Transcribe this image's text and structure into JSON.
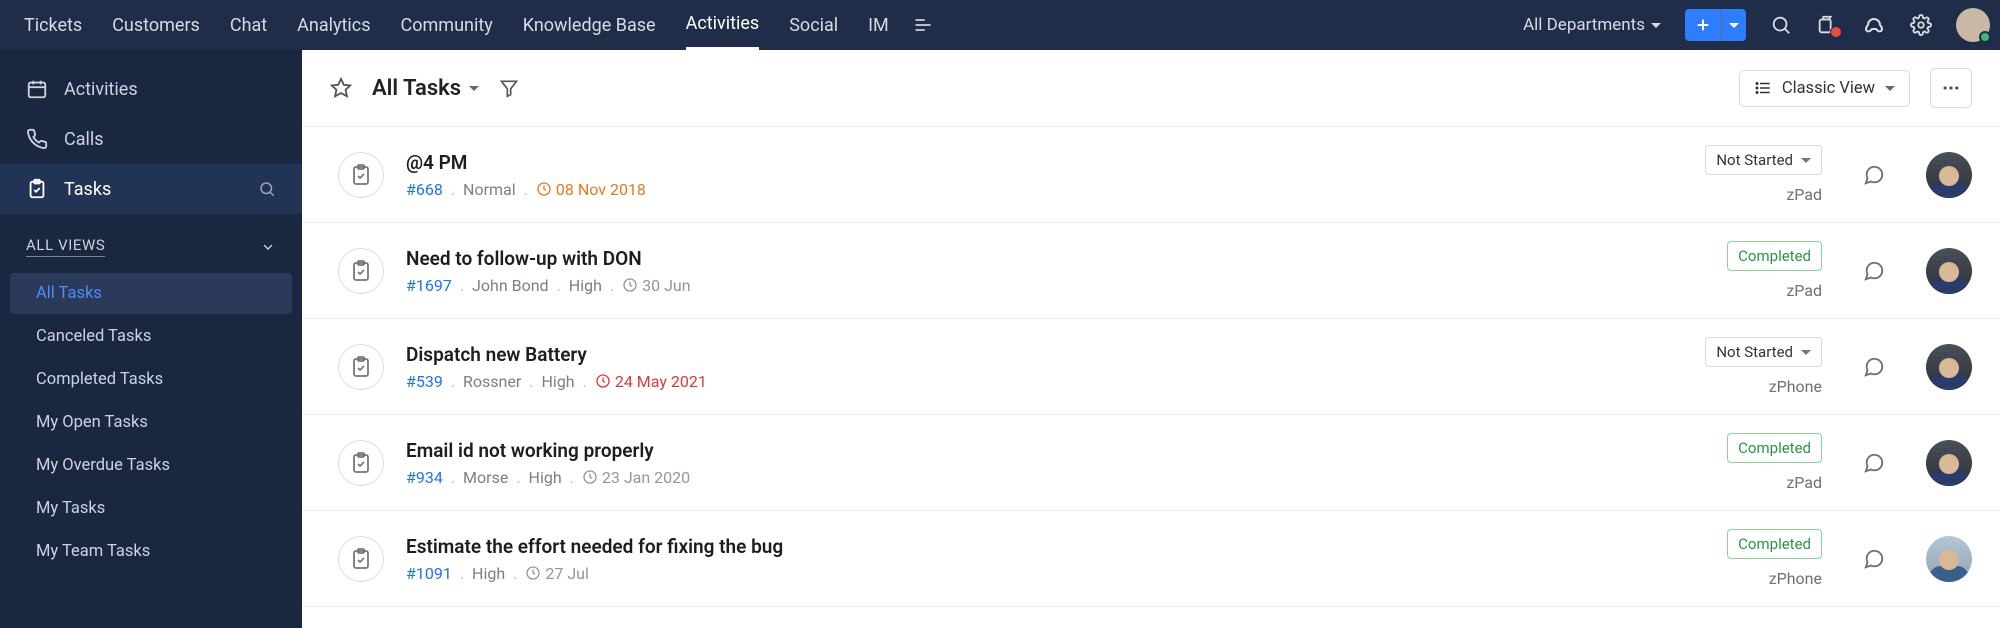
{
  "topnav": {
    "tabs": [
      "Tickets",
      "Customers",
      "Chat",
      "Analytics",
      "Community",
      "Knowledge Base",
      "Activities",
      "Social",
      "IM"
    ],
    "active_index": 6,
    "department_label": "All Departments"
  },
  "sidebar": {
    "primary": [
      {
        "icon": "calendar",
        "label": "Activities"
      },
      {
        "icon": "phone",
        "label": "Calls"
      },
      {
        "icon": "task",
        "label": "Tasks",
        "selected": true,
        "search": true
      }
    ],
    "section_label": "ALL VIEWS",
    "views": [
      {
        "label": "All Tasks",
        "active": true
      },
      {
        "label": "Canceled Tasks"
      },
      {
        "label": "Completed Tasks"
      },
      {
        "label": "My Open Tasks"
      },
      {
        "label": "My Overdue Tasks"
      },
      {
        "label": "My Tasks"
      },
      {
        "label": "My Team Tasks"
      }
    ]
  },
  "toolbar": {
    "title": "All Tasks",
    "view_mode_label": "Classic View"
  },
  "tasks": [
    {
      "title": "@4 PM",
      "id": "#668",
      "meta": [
        "Normal"
      ],
      "due": "08 Nov 2018",
      "due_style": "orange",
      "status": "Not Started",
      "status_kind": "dropdown",
      "category": "zPad",
      "avatar": "a"
    },
    {
      "title": "Need to follow-up with DON",
      "id": "#1697",
      "meta": [
        "John Bond",
        "High"
      ],
      "due": "30 Jun",
      "due_style": "grey",
      "status": "Completed",
      "status_kind": "completed",
      "category": "zPad",
      "avatar": "a"
    },
    {
      "title": "Dispatch new Battery",
      "id": "#539",
      "meta": [
        "Rossner",
        "High"
      ],
      "due": "24 May 2021",
      "due_style": "red",
      "status": "Not Started",
      "status_kind": "dropdown",
      "category": "zPhone",
      "avatar": "a"
    },
    {
      "title": "Email id not working properly",
      "id": "#934",
      "meta": [
        "Morse",
        "High"
      ],
      "due": "23 Jan 2020",
      "due_style": "grey",
      "status": "Completed",
      "status_kind": "completed",
      "category": "zPad",
      "avatar": "a"
    },
    {
      "title": "Estimate the effort needed for fixing the bug",
      "id": "#1091",
      "meta": [
        "High"
      ],
      "due": "27 Jul",
      "due_style": "grey",
      "status": "Completed",
      "status_kind": "completed",
      "category": "zPhone",
      "avatar": "b"
    }
  ]
}
